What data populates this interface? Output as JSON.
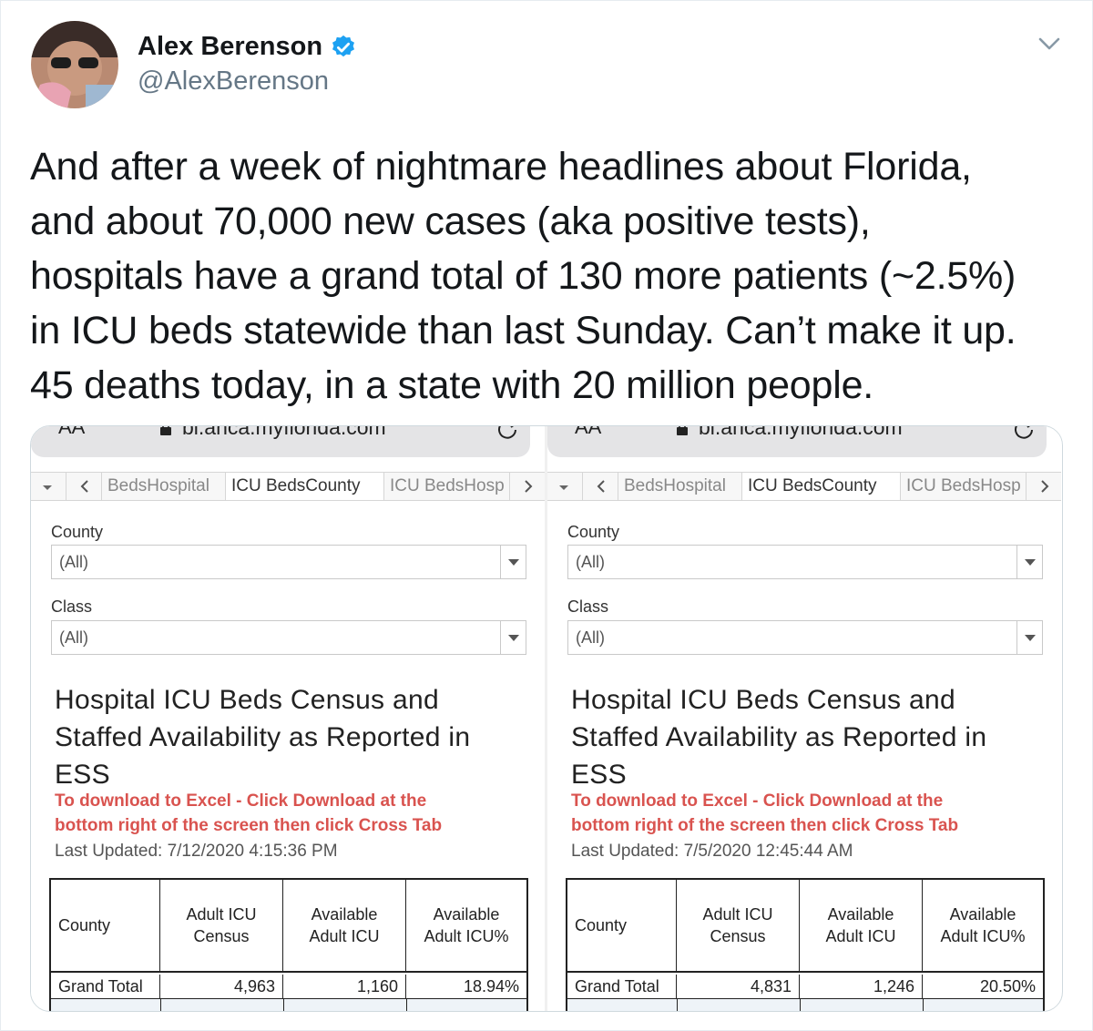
{
  "author": {
    "name": "Alex Berenson",
    "handle": "@AlexBerenson"
  },
  "icons": {
    "verified": "verified-badge-icon",
    "menu": "chevron-down-icon",
    "lock": "lock-icon",
    "reload": "reload-icon"
  },
  "colors": {
    "verified": "#1da1f2",
    "instruction": "#d9534f",
    "handle": "#657786"
  },
  "tweet": {
    "lines": [
      "And after a week of nightmare headlines about Florida,",
      "and about 70,000 new cases (aka positive tests),",
      "hospitals have a grand total of 130 more patients (~2.5%)",
      "in ICU beds statewide than last Sunday. Can’t make it up.",
      "45 deaths today, in a state with 20 million people."
    ]
  },
  "panels": [
    {
      "browser": {
        "aa": "AA",
        "url": "bi.ahca.myflorida.com"
      },
      "tabs": [
        "BedsHospital",
        "ICU BedsCounty",
        "ICU BedsHosp"
      ],
      "filters": [
        {
          "label": "County",
          "value": "(All)"
        },
        {
          "label": "Class",
          "value": "(All)"
        }
      ],
      "title_lines": [
        "Hospital ICU Beds Census and",
        "Staffed Availability as Reported in",
        "ESS"
      ],
      "instruction_lines": [
        "To download to Excel - Click Download at the",
        "bottom right of the screen then click Cross Tab"
      ],
      "last_updated": "Last Updated: 7/12/2020 4:15:36 PM",
      "table": {
        "headers": [
          "County",
          "Adult ICU Census",
          "Available Adult ICU",
          "Available Adult ICU%"
        ],
        "rows": [
          [
            "Grand Total",
            "4,963",
            "1,160",
            "18.94%"
          ]
        ]
      }
    },
    {
      "browser": {
        "aa": "AA",
        "url": "bi.ahca.myflorida.com"
      },
      "tabs": [
        "BedsHospital",
        "ICU BedsCounty",
        "ICU BedsHosp"
      ],
      "filters": [
        {
          "label": "County",
          "value": "(All)"
        },
        {
          "label": "Class",
          "value": "(All)"
        }
      ],
      "title_lines": [
        "Hospital ICU Beds Census and",
        "Staffed Availability as Reported in",
        "ESS"
      ],
      "instruction_lines": [
        "To download to Excel - Click Download at the",
        "bottom right of the screen then click Cross Tab"
      ],
      "last_updated": "Last Updated: 7/5/2020 12:45:44 AM",
      "table": {
        "headers": [
          "County",
          "Adult ICU Census",
          "Available Adult ICU",
          "Available Adult ICU%"
        ],
        "rows": [
          [
            "Grand Total",
            "4,831",
            "1,246",
            "20.50%"
          ]
        ]
      }
    }
  ]
}
